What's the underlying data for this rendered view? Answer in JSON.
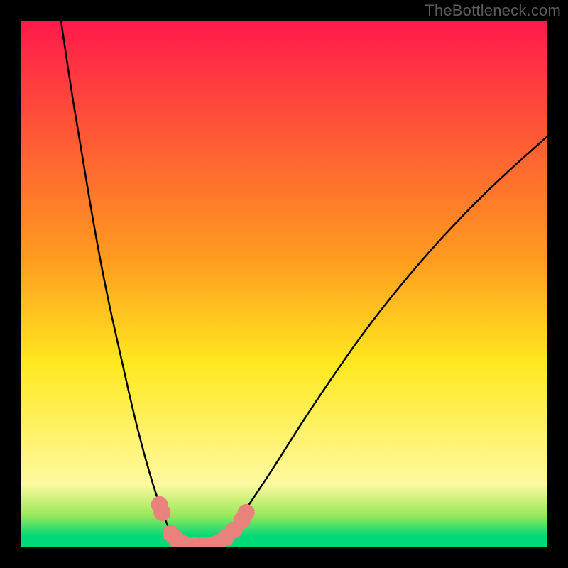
{
  "watermark": "TheBottleneck.com",
  "chart_data": {
    "type": "line",
    "title": "",
    "xlabel": "",
    "ylabel": "",
    "xlim": [
      0,
      100
    ],
    "ylim": [
      0,
      100
    ],
    "background_gradient": {
      "bands": [
        {
          "y": 100,
          "color": "#ff1a4b"
        },
        {
          "y": 55,
          "color": "#ff9b1f"
        },
        {
          "y": 35,
          "color": "#ffe81f"
        },
        {
          "y": 12,
          "color": "#fff9a0"
        },
        {
          "y": 6,
          "color": "#9be85a"
        },
        {
          "y": 2,
          "color": "#00d977"
        },
        {
          "y": 0,
          "color": "#00d977"
        }
      ]
    },
    "series": [
      {
        "name": "bottleneck-curve-left",
        "type": "line",
        "color": "#000000",
        "width": 2.5,
        "points": [
          {
            "x": 7.0,
            "y": 104.0
          },
          {
            "x": 9.0,
            "y": 90.0
          },
          {
            "x": 11.5,
            "y": 75.0
          },
          {
            "x": 14.0,
            "y": 60.0
          },
          {
            "x": 16.5,
            "y": 47.0
          },
          {
            "x": 19.0,
            "y": 36.0
          },
          {
            "x": 21.0,
            "y": 27.0
          },
          {
            "x": 23.0,
            "y": 19.0
          },
          {
            "x": 25.0,
            "y": 12.0
          },
          {
            "x": 26.5,
            "y": 7.5
          },
          {
            "x": 28.0,
            "y": 3.5
          },
          {
            "x": 30.0,
            "y": 1.0
          },
          {
            "x": 31.5,
            "y": 0.2
          }
        ]
      },
      {
        "name": "bottleneck-curve-right",
        "type": "line",
        "color": "#000000",
        "width": 2.5,
        "points": [
          {
            "x": 36.0,
            "y": 0.2
          },
          {
            "x": 38.5,
            "y": 1.5
          },
          {
            "x": 41.0,
            "y": 4.5
          },
          {
            "x": 44.0,
            "y": 9.0
          },
          {
            "x": 48.0,
            "y": 15.0
          },
          {
            "x": 53.0,
            "y": 23.0
          },
          {
            "x": 59.0,
            "y": 32.0
          },
          {
            "x": 66.0,
            "y": 42.0
          },
          {
            "x": 74.0,
            "y": 52.0
          },
          {
            "x": 82.0,
            "y": 61.0
          },
          {
            "x": 91.0,
            "y": 70.0
          },
          {
            "x": 100.0,
            "y": 78.0
          }
        ]
      },
      {
        "name": "highlighted-markers",
        "type": "scatter",
        "color": "#e9817d",
        "marker_size": 12,
        "points": [
          {
            "x": 26.3,
            "y": 8.0
          },
          {
            "x": 26.8,
            "y": 6.5
          },
          {
            "x": 28.5,
            "y": 2.5
          },
          {
            "x": 29.5,
            "y": 1.4
          },
          {
            "x": 31.0,
            "y": 0.5
          },
          {
            "x": 33.0,
            "y": 0.2
          },
          {
            "x": 34.5,
            "y": 0.2
          },
          {
            "x": 36.0,
            "y": 0.3
          },
          {
            "x": 37.5,
            "y": 0.8
          },
          {
            "x": 39.0,
            "y": 1.8
          },
          {
            "x": 40.5,
            "y": 3.2
          },
          {
            "x": 42.0,
            "y": 5.0
          },
          {
            "x": 42.8,
            "y": 6.5
          }
        ]
      }
    ]
  }
}
